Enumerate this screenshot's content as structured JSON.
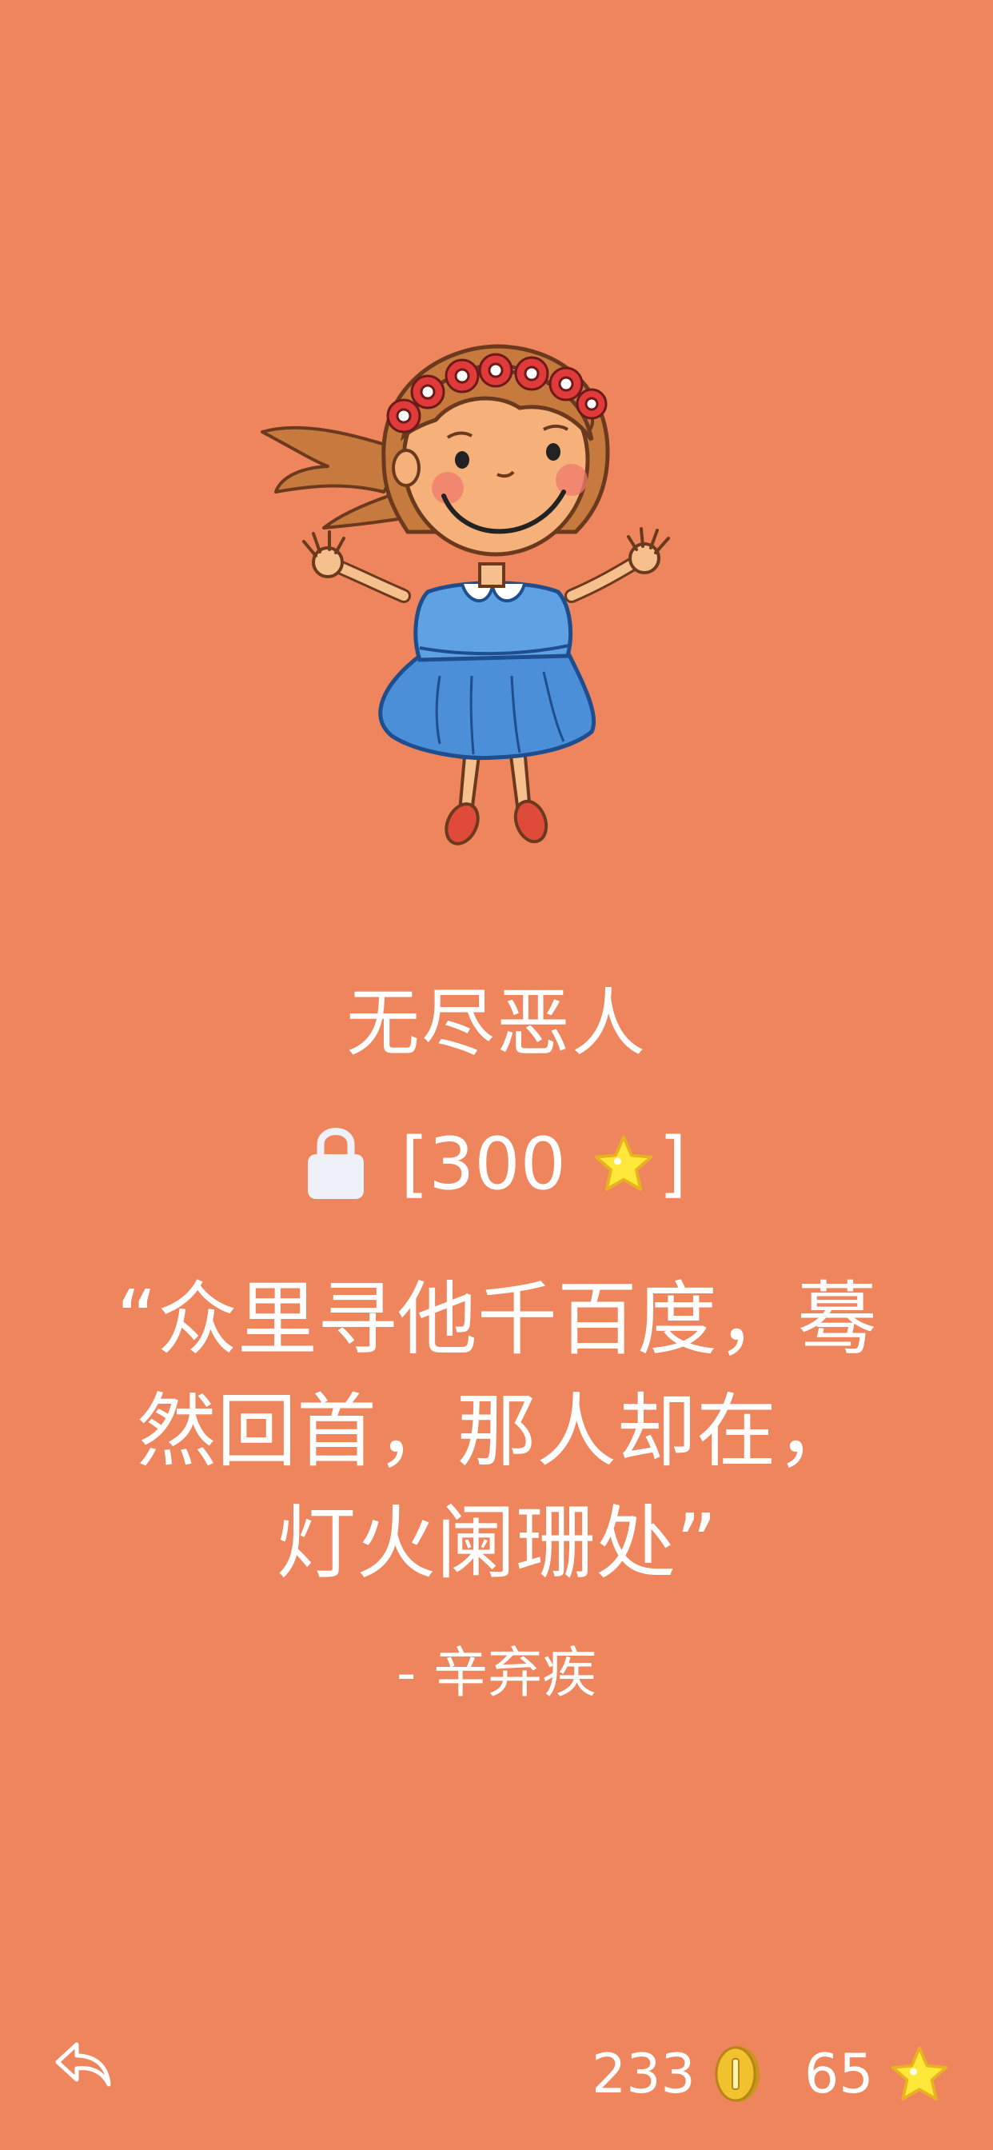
{
  "character": {
    "name": "无尽恶人",
    "locked": true,
    "price": {
      "open_bracket": "[",
      "amount": "300",
      "close_bracket": "]",
      "currency_icon": "star-icon"
    }
  },
  "quote": {
    "line1": "“众里寻他千百度，蓦",
    "line2": "然回首，那人却在，",
    "line3": "灯火阑珊处”",
    "author": "-  辛弃疾"
  },
  "footer": {
    "back_icon": "back-arrow-icon",
    "coins": "233",
    "coins_icon": "coin-icon",
    "stars": "65",
    "stars_icon": "star-icon"
  },
  "colors": {
    "background": "#EF855C",
    "text": "#FFFFFF",
    "lock": "#EEF1F8",
    "star": "#FFE83A",
    "coin": "#F2C22E",
    "dress": "#4A8FD8",
    "hair": "#C77A3E"
  }
}
